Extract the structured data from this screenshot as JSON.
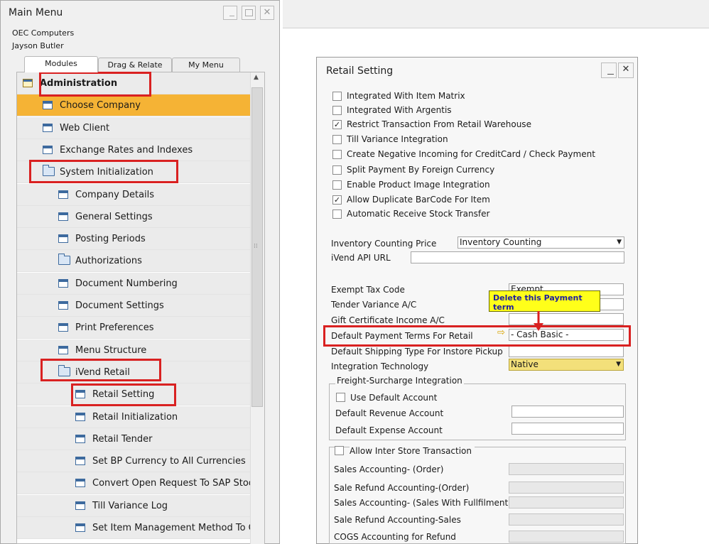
{
  "main_menu": {
    "title": "Main Menu",
    "window_buttons": {
      "minimize": "_",
      "maximize": "□",
      "close": "✕"
    },
    "company": "OEC Computers",
    "user": "Jayson Butler",
    "tabs": [
      {
        "label": "Modules",
        "active": true
      },
      {
        "label": "Drag & Relate",
        "active": false
      },
      {
        "label": "My Menu",
        "active": false
      }
    ],
    "items": [
      {
        "label": "Administration",
        "level": 0,
        "icon": "module-icon",
        "bold": true
      },
      {
        "label": "Choose Company",
        "level": 1,
        "icon": "form-icon",
        "selected": true
      },
      {
        "label": "Web Client",
        "level": 1,
        "icon": "form-icon"
      },
      {
        "label": "Exchange Rates and Indexes",
        "level": 1,
        "icon": "form-icon"
      },
      {
        "label": "System Initialization",
        "level": 1,
        "icon": "folder-open-icon"
      },
      {
        "label": "Company Details",
        "level": 2,
        "icon": "form-icon"
      },
      {
        "label": "General Settings",
        "level": 2,
        "icon": "form-icon"
      },
      {
        "label": "Posting Periods",
        "level": 2,
        "icon": "form-icon"
      },
      {
        "label": "Authorizations",
        "level": 2,
        "icon": "folder-closed-icon"
      },
      {
        "label": "Document Numbering",
        "level": 2,
        "icon": "form-icon"
      },
      {
        "label": "Document Settings",
        "level": 2,
        "icon": "form-icon"
      },
      {
        "label": "Print Preferences",
        "level": 2,
        "icon": "form-icon"
      },
      {
        "label": "Menu Structure",
        "level": 2,
        "icon": "form-icon"
      },
      {
        "label": "iVend Retail",
        "level": 2,
        "icon": "folder-open-icon"
      },
      {
        "label": "Retail Setting",
        "level": 3,
        "icon": "form-icon"
      },
      {
        "label": "Retail Initialization",
        "level": 3,
        "icon": "form-icon"
      },
      {
        "label": "Retail Tender",
        "level": 3,
        "icon": "form-icon"
      },
      {
        "label": "Set BP Currency to All Currencies",
        "level": 3,
        "icon": "form-icon"
      },
      {
        "label": "Convert Open Request To SAP Stock",
        "level": 3,
        "icon": "form-icon"
      },
      {
        "label": "Till Variance Log",
        "level": 3,
        "icon": "form-icon"
      },
      {
        "label": "Set Item Management Method To On",
        "level": 3,
        "icon": "form-icon"
      }
    ]
  },
  "retail_setting": {
    "title": "Retail Setting",
    "window_buttons": {
      "minimize": "_",
      "close": "✕"
    },
    "checkboxes": [
      {
        "label": "Integrated With Item Matrix",
        "checked": false
      },
      {
        "label": "Integrated With Argentis",
        "checked": false
      },
      {
        "label": "Restrict Transaction From Retail Warehouse",
        "checked": true
      },
      {
        "label": "Till Variance Integration",
        "checked": false
      },
      {
        "label": "Create Negative Incoming for CreditCard / Check Payment",
        "checked": false
      },
      {
        "label": "Split Payment By Foreign Currency",
        "checked": false
      },
      {
        "label": "Enable Product Image Integration",
        "checked": false
      },
      {
        "label": "Allow Duplicate BarCode For Item",
        "checked": true
      },
      {
        "label": "Automatic Receive Stock Transfer",
        "checked": false
      }
    ],
    "inventory_counting_price": {
      "label": "Inventory Counting Price",
      "value": "Inventory Counting"
    },
    "ivend_api_url": {
      "label": "iVend API URL",
      "value": ""
    },
    "exempt_tax_code": {
      "label": "Exempt Tax Code",
      "value": "Exempt"
    },
    "tender_variance": {
      "label": "Tender Variance A/C",
      "value": ""
    },
    "gift_certificate": {
      "label": "Gift Certificate Income A/C",
      "value": ""
    },
    "default_payment_terms": {
      "label": "Default Payment Terms For Retail",
      "value": "- Cash Basic -"
    },
    "default_shipping": {
      "label": "Default Shipping Type For Instore Pickup",
      "value": ""
    },
    "integration_technology": {
      "label": "Integration Technology",
      "value": "Native"
    },
    "freight_group": {
      "title": "Freight-Surcharge Integration",
      "use_default": {
        "label": "Use Default Account",
        "checked": false
      },
      "revenue": {
        "label": "Default Revenue Account",
        "value": ""
      },
      "expense": {
        "label": "Default Expense Account",
        "value": ""
      }
    },
    "inter_store": {
      "label": "Allow Inter Store Transaction",
      "checked": false,
      "fields": [
        "Sales Accounting- (Order)",
        "Sale Refund Accounting-(Order)",
        "Sales Accounting- (Sales With Fullfilment)",
        "Sale Refund Accounting-Sales",
        "COGS Accounting for Refund"
      ]
    }
  },
  "callout": {
    "text": "Delete this Payment term",
    "color": "#ffff1a"
  },
  "colors": {
    "highlight_border": "#d92121",
    "selected_row": "#f5b335",
    "icon_blue": "#3d6a9e"
  }
}
